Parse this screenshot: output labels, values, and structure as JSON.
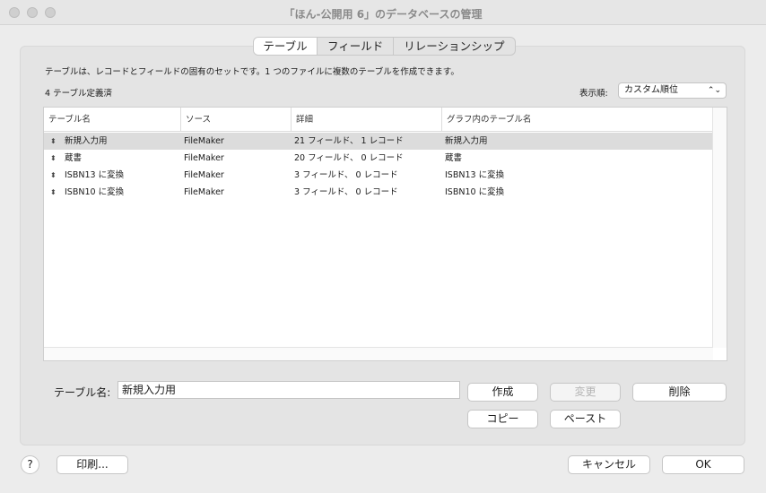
{
  "window": {
    "title": "「ほん-公開用 6」のデータベースの管理"
  },
  "tabs": [
    {
      "label": "テーブル",
      "active": true
    },
    {
      "label": "フィールド",
      "active": false
    },
    {
      "label": "リレーションシップ",
      "active": false
    }
  ],
  "description": "テーブルは、レコードとフィールドの固有のセットです。1 つのファイルに複数のテーブルを作成できます。",
  "table_count": "4 テーブル定義済",
  "sort": {
    "label": "表示順:",
    "selected": "カスタム順位"
  },
  "table": {
    "columns": [
      "テーブル名",
      "ソース",
      "詳細",
      "グラフ内のテーブル名"
    ],
    "rows": [
      {
        "name": "新規入力用",
        "source": "FileMaker",
        "details": "21 フィールド、 1 レコード",
        "graph_name": "新規入力用",
        "selected": true
      },
      {
        "name": "蔵書",
        "source": "FileMaker",
        "details": "20 フィールド、 0 レコード",
        "graph_name": "蔵書",
        "selected": false
      },
      {
        "name": "ISBN13 に変換",
        "source": "FileMaker",
        "details": "3 フィールド、 0 レコード",
        "graph_name": "ISBN13 に変換",
        "selected": false
      },
      {
        "name": "ISBN10 に変換",
        "source": "FileMaker",
        "details": "3 フィールド、 0 レコード",
        "graph_name": "ISBN10 に変換",
        "selected": false
      }
    ]
  },
  "name_field": {
    "label": "テーブル名:",
    "value": "新規入力用"
  },
  "buttons": {
    "create": "作成",
    "change": "変更",
    "delete": "削除",
    "copy": "コピー",
    "paste": "ペースト",
    "print": "印刷...",
    "cancel": "キャンセル",
    "ok": "OK",
    "help": "?"
  },
  "icons": {
    "row_handle": "updown-arrows-icon",
    "select_arrow": "chevron-updown-icon"
  }
}
